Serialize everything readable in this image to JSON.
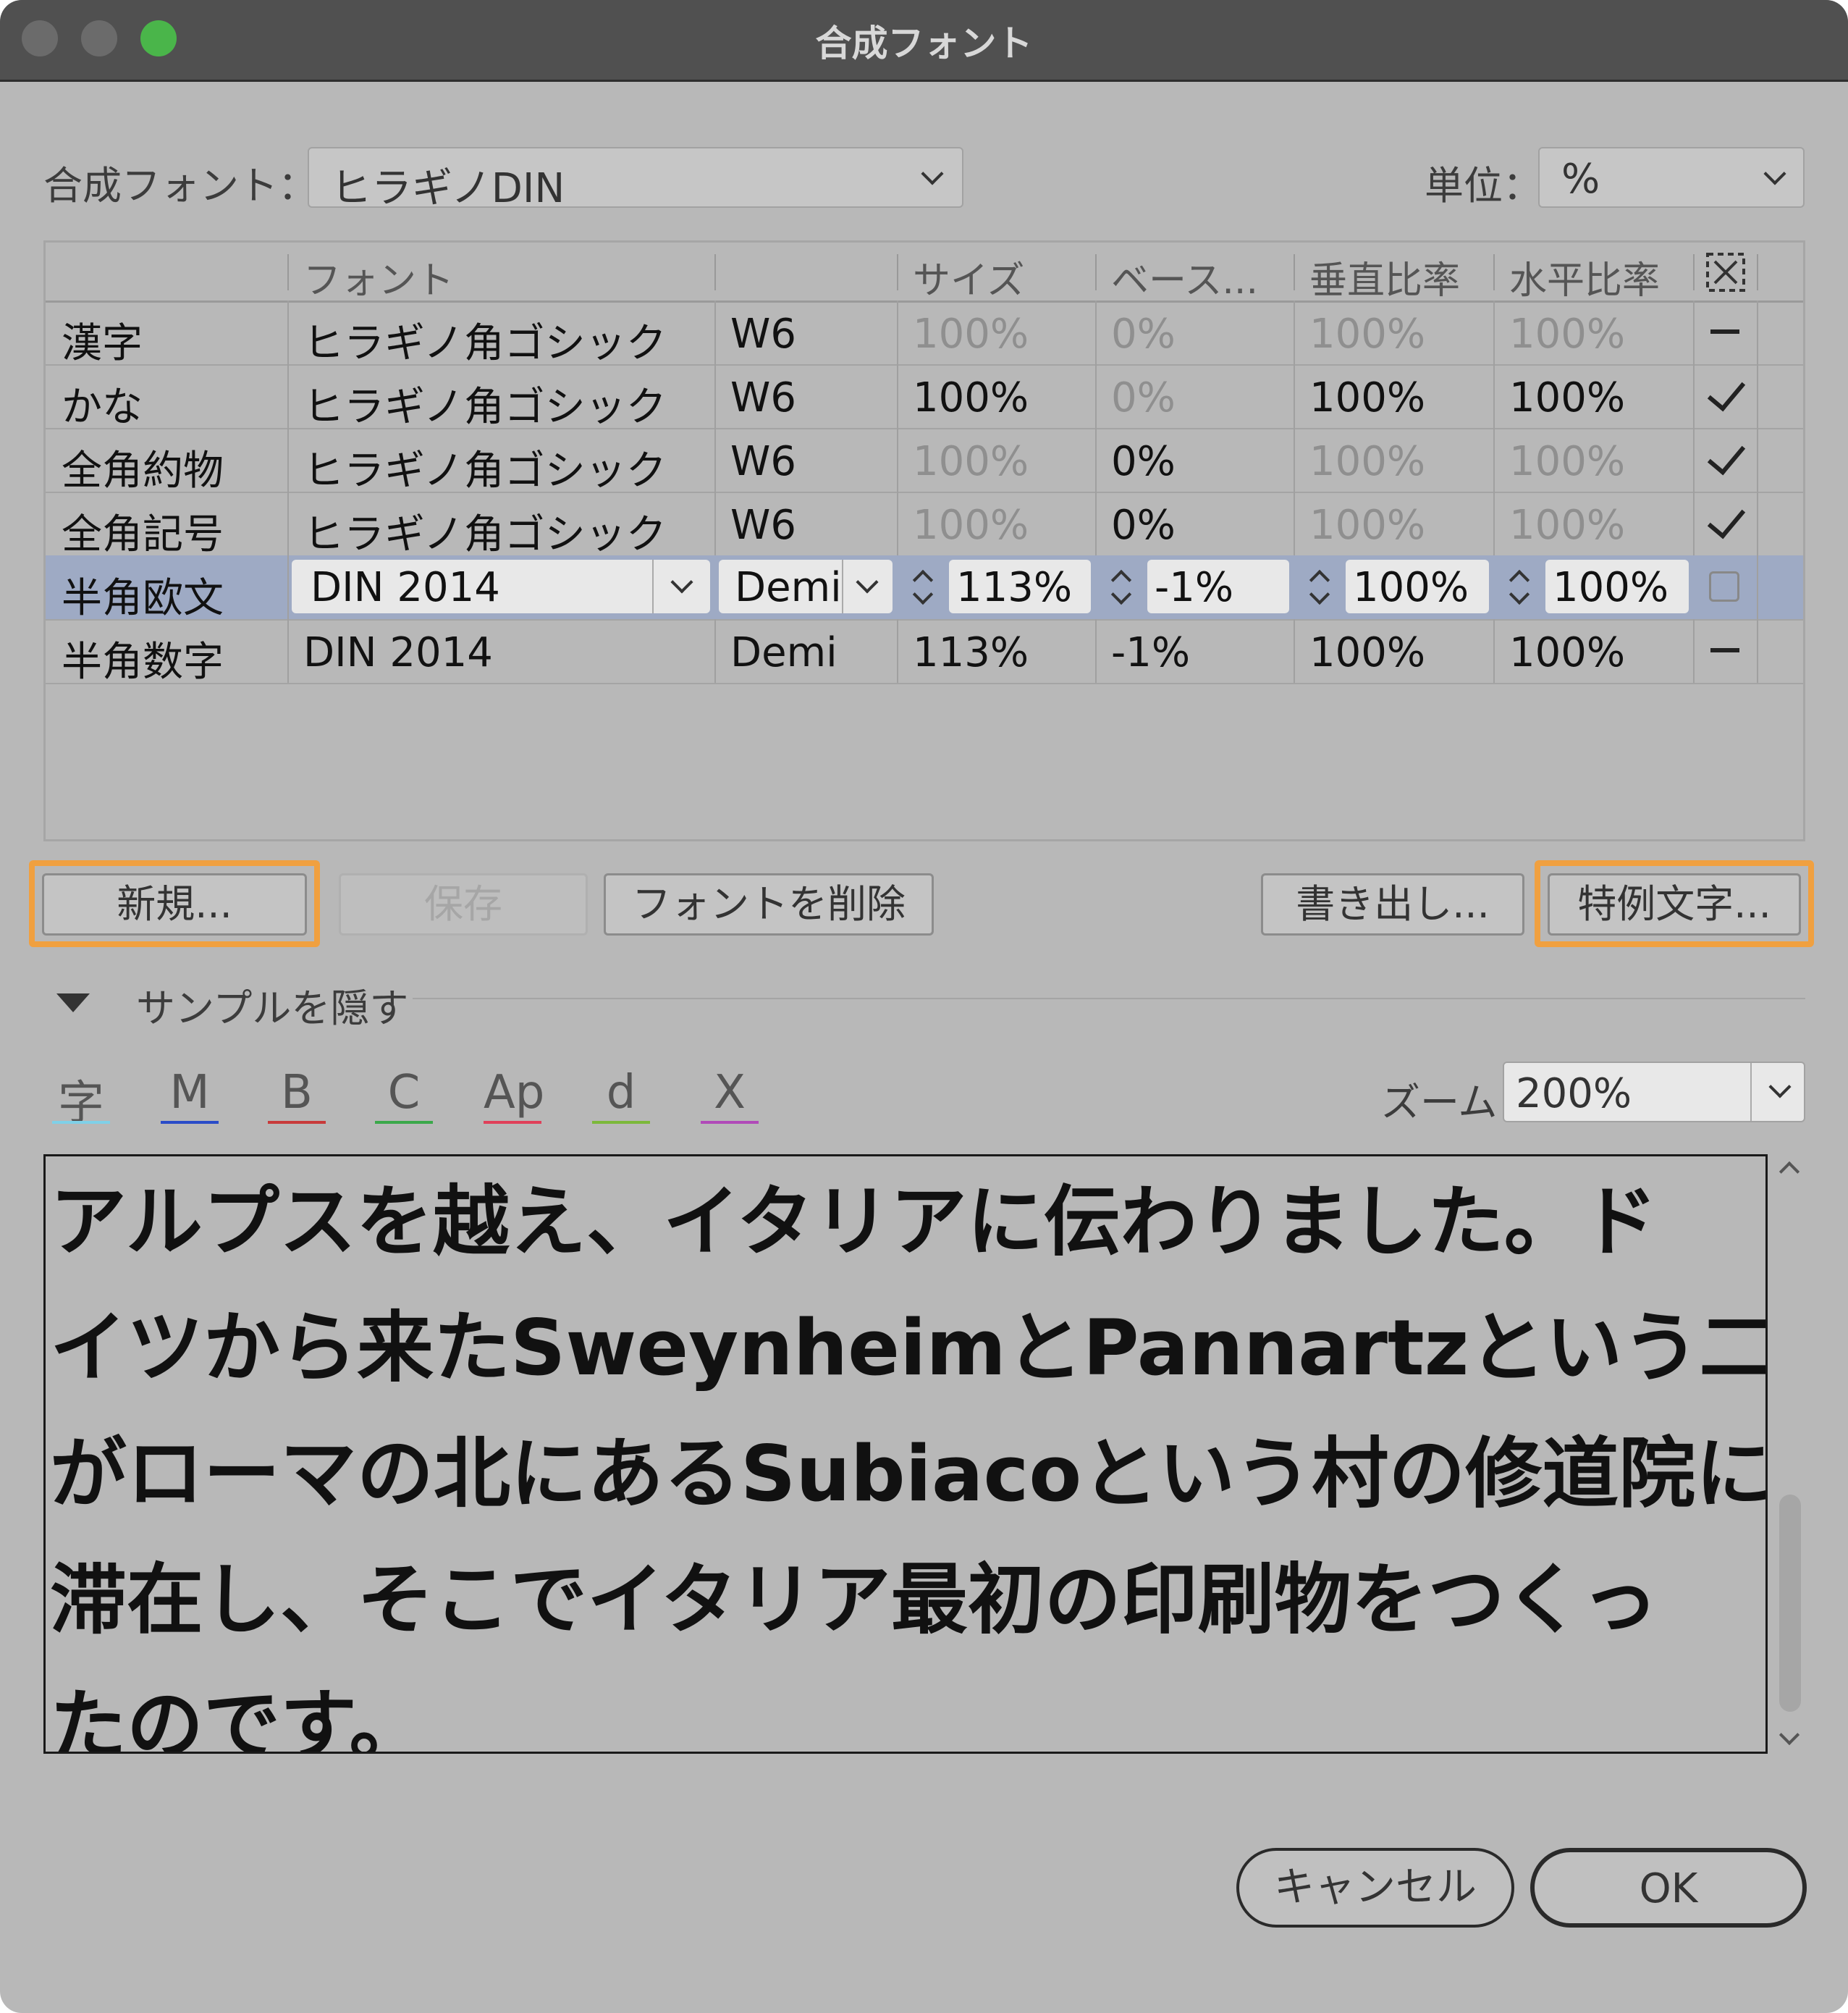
{
  "window": {
    "title": "合成フォント"
  },
  "controls": {
    "font_label": "合成フォント：",
    "font_value": "ヒラギノDIN",
    "unit_label": "単位：",
    "unit_value": "%"
  },
  "table": {
    "headers": [
      "フォント",
      "サイズ",
      "ベース...",
      "垂直比率",
      "水平比率"
    ],
    "rows": [
      {
        "name": "漢字",
        "font": "ヒラギノ角ゴシック",
        "style": "W6",
        "size": "100%",
        "base": "0%",
        "vscale": "100%",
        "hscale": "100%",
        "mark": "dash"
      },
      {
        "name": "かな",
        "font": "ヒラギノ角ゴシック",
        "style": "W6",
        "size": "100%",
        "base": "0%",
        "vscale": "100%",
        "hscale": "100%",
        "mark": "check"
      },
      {
        "name": "全角約物",
        "font": "ヒラギノ角ゴシック",
        "style": "W6",
        "size": "100%",
        "base": "0%",
        "vscale": "100%",
        "hscale": "100%",
        "mark": "check"
      },
      {
        "name": "全角記号",
        "font": "ヒラギノ角ゴシック",
        "style": "W6",
        "size": "100%",
        "base": "0%",
        "vscale": "100%",
        "hscale": "100%",
        "mark": "check"
      },
      {
        "name": "半角欧文",
        "font": "DIN 2014",
        "style": "Demi",
        "size": "113%",
        "base": "-1%",
        "vscale": "100%",
        "hscale": "100%",
        "mark": "box"
      },
      {
        "name": "半角数字",
        "font": "DIN 2014",
        "style": "Demi",
        "size": "113%",
        "base": "-1%",
        "vscale": "100%",
        "hscale": "100%",
        "mark": "dash"
      }
    ]
  },
  "buttons": {
    "new": "新規...",
    "save": "保存",
    "delete": "フォントを削除",
    "export": "書き出し...",
    "special": "特例文字..."
  },
  "sample": {
    "toggle": "サンプルを隠す",
    "tools": [
      "字",
      "M",
      "B",
      "C",
      "Ap",
      "d",
      "X"
    ],
    "zoom_label": "ズーム",
    "zoom_value": "200%",
    "lines": [
      "アルプスを越え、イタリアに伝わりました。ド",
      "イツから来たSweynheimとPannartzという二人",
      "がローマの北にあるSubiacoという村の修道院に",
      "滞在し、そこでイタリア最初の印刷物をつくっ",
      "たのです。"
    ]
  },
  "footer": {
    "cancel": "キャンセル",
    "ok": "OK"
  }
}
